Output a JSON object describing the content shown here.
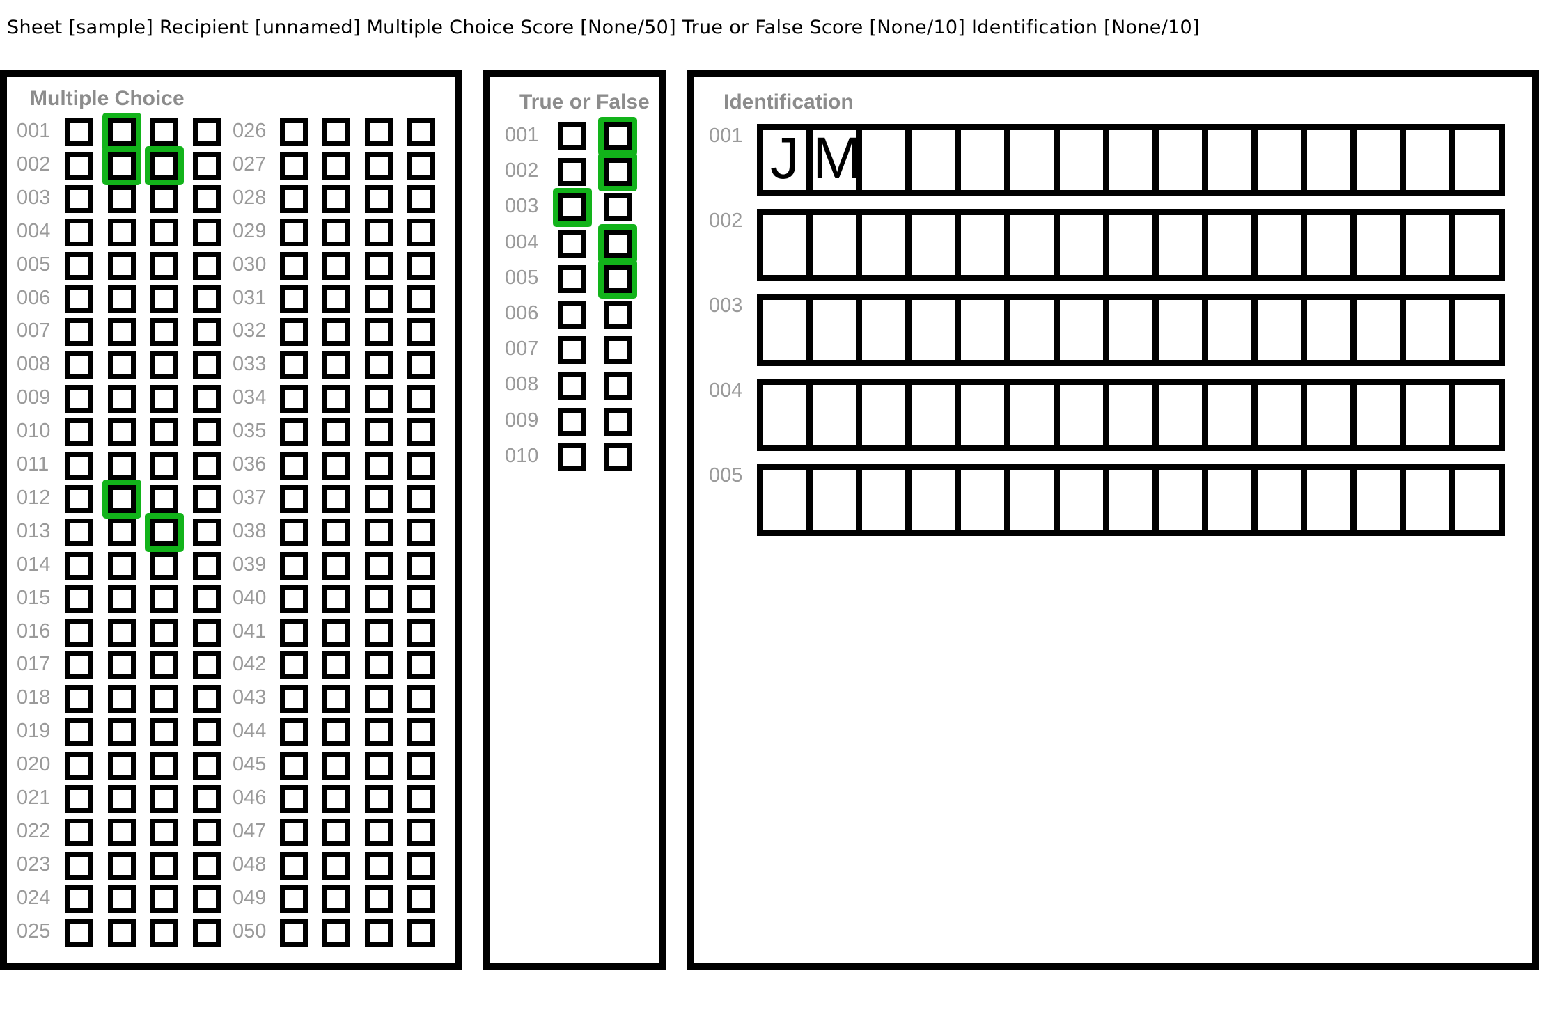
{
  "header": {
    "text": "Sheet [sample] Recipient [unnamed] Multiple Choice Score [None/50] True or False Score [None/10] Identification [None/10]"
  },
  "multiple_choice": {
    "title": "Multiple Choice",
    "options_per_item": 4,
    "items": [
      {
        "num": "001",
        "selected": [
          1
        ]
      },
      {
        "num": "002",
        "selected": [
          1,
          2
        ]
      },
      {
        "num": "003",
        "selected": []
      },
      {
        "num": "004",
        "selected": []
      },
      {
        "num": "005",
        "selected": []
      },
      {
        "num": "006",
        "selected": []
      },
      {
        "num": "007",
        "selected": []
      },
      {
        "num": "008",
        "selected": []
      },
      {
        "num": "009",
        "selected": []
      },
      {
        "num": "010",
        "selected": []
      },
      {
        "num": "011",
        "selected": []
      },
      {
        "num": "012",
        "selected": [
          1
        ]
      },
      {
        "num": "013",
        "selected": [
          2
        ]
      },
      {
        "num": "014",
        "selected": []
      },
      {
        "num": "015",
        "selected": []
      },
      {
        "num": "016",
        "selected": []
      },
      {
        "num": "017",
        "selected": []
      },
      {
        "num": "018",
        "selected": []
      },
      {
        "num": "019",
        "selected": []
      },
      {
        "num": "020",
        "selected": []
      },
      {
        "num": "021",
        "selected": []
      },
      {
        "num": "022",
        "selected": []
      },
      {
        "num": "023",
        "selected": []
      },
      {
        "num": "024",
        "selected": []
      },
      {
        "num": "025",
        "selected": []
      },
      {
        "num": "026",
        "selected": []
      },
      {
        "num": "027",
        "selected": []
      },
      {
        "num": "028",
        "selected": []
      },
      {
        "num": "029",
        "selected": []
      },
      {
        "num": "030",
        "selected": []
      },
      {
        "num": "031",
        "selected": []
      },
      {
        "num": "032",
        "selected": []
      },
      {
        "num": "033",
        "selected": []
      },
      {
        "num": "034",
        "selected": []
      },
      {
        "num": "035",
        "selected": []
      },
      {
        "num": "036",
        "selected": []
      },
      {
        "num": "037",
        "selected": []
      },
      {
        "num": "038",
        "selected": []
      },
      {
        "num": "039",
        "selected": []
      },
      {
        "num": "040",
        "selected": []
      },
      {
        "num": "041",
        "selected": []
      },
      {
        "num": "042",
        "selected": []
      },
      {
        "num": "043",
        "selected": []
      },
      {
        "num": "044",
        "selected": []
      },
      {
        "num": "045",
        "selected": []
      },
      {
        "num": "046",
        "selected": []
      },
      {
        "num": "047",
        "selected": []
      },
      {
        "num": "048",
        "selected": []
      },
      {
        "num": "049",
        "selected": []
      },
      {
        "num": "050",
        "selected": []
      }
    ]
  },
  "true_false": {
    "title": "True or False",
    "options_per_item": 2,
    "items": [
      {
        "num": "001",
        "selected": [
          1
        ]
      },
      {
        "num": "002",
        "selected": [
          1
        ]
      },
      {
        "num": "003",
        "selected": [
          0
        ]
      },
      {
        "num": "004",
        "selected": [
          1
        ]
      },
      {
        "num": "005",
        "selected": [
          1
        ]
      },
      {
        "num": "006",
        "selected": []
      },
      {
        "num": "007",
        "selected": []
      },
      {
        "num": "008",
        "selected": []
      },
      {
        "num": "009",
        "selected": []
      },
      {
        "num": "010",
        "selected": []
      }
    ]
  },
  "identification": {
    "title": "Identification",
    "cells_per_row": 15,
    "items": [
      {
        "num": "001",
        "chars": [
          "J",
          "M"
        ]
      },
      {
        "num": "002",
        "chars": []
      },
      {
        "num": "003",
        "chars": []
      },
      {
        "num": "004",
        "chars": []
      },
      {
        "num": "005",
        "chars": []
      }
    ]
  }
}
